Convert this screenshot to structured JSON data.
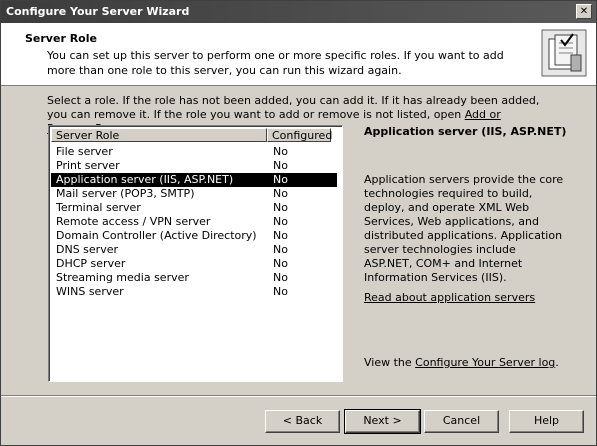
{
  "window": {
    "title": "Configure Your Server Wizard",
    "close_glyph": "✕"
  },
  "header": {
    "title": "Server Role",
    "description": "You can set up this server to perform one or more specific roles. If you want to add more than one role to this server, you can run this wizard again.",
    "icon": "wizard-checklist-icon"
  },
  "instructions": {
    "text": "Select a role. If the role has not been added, you can add it. If it has already been added, you can remove it. If the role you want to add or remove is not listed, open ",
    "link": "Add or Remove Programs",
    "suffix": "."
  },
  "list": {
    "columns": [
      "Server Role",
      "Configured"
    ],
    "rows": [
      {
        "role": "File server",
        "configured": "No"
      },
      {
        "role": "Print server",
        "configured": "No"
      },
      {
        "role": "Application server (IIS, ASP.NET)",
        "configured": "No",
        "selected": true
      },
      {
        "role": "Mail server (POP3, SMTP)",
        "configured": "No"
      },
      {
        "role": "Terminal server",
        "configured": "No"
      },
      {
        "role": "Remote access / VPN server",
        "configured": "No"
      },
      {
        "role": "Domain Controller (Active Directory)",
        "configured": "No"
      },
      {
        "role": "DNS server",
        "configured": "No"
      },
      {
        "role": "DHCP server",
        "configured": "No"
      },
      {
        "role": "Streaming media server",
        "configured": "No"
      },
      {
        "role": "WINS server",
        "configured": "No"
      }
    ]
  },
  "detail": {
    "title": "Application server (IIS, ASP.NET)",
    "description": "Application servers provide the core technologies required to build, deploy, and operate XML Web Services, Web applications, and distributed applications. Application server technologies include ASP.NET, COM+ and Internet Information Services (IIS).",
    "link": "Read about application servers",
    "log_prefix": "View the ",
    "log_link": "Configure Your Server log",
    "log_suffix": "."
  },
  "buttons": {
    "back": "< Back",
    "next": "Next >",
    "cancel": "Cancel",
    "help": "Help"
  }
}
